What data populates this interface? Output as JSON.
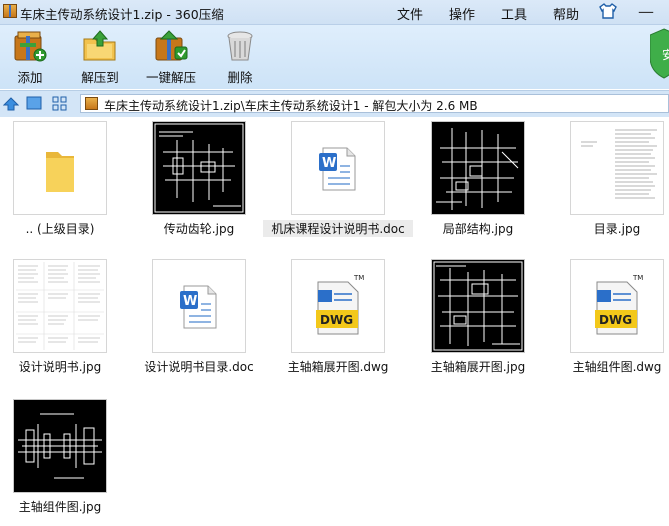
{
  "window": {
    "title": "车床主传动系统设计1.zip - 360压缩",
    "menu": [
      "文件",
      "操作",
      "工具",
      "帮助"
    ],
    "minimize_glyph": "—"
  },
  "toolbar": {
    "add": "添加",
    "extract_to": "解压到",
    "one_click_extract": "一键解压",
    "delete": "删除"
  },
  "address": {
    "path": "车床主传动系统设计1.zip\\车床主传动系统设计1 - 解包大小为 2.6 MB"
  },
  "files": [
    {
      "name": ".. (上级目录)",
      "kind": "folder",
      "icon": "folder-icon"
    },
    {
      "name": "传动齿轮.jpg",
      "kind": "jpg-dark",
      "icon": "image-thumbnail"
    },
    {
      "name": "机床课程设计说明书.doc",
      "kind": "doc",
      "icon": "word-doc-icon"
    },
    {
      "name": "局部结构.jpg",
      "kind": "jpg-dark",
      "icon": "image-thumbnail"
    },
    {
      "name": "目录.jpg",
      "kind": "jpg-doc",
      "icon": "image-thumbnail"
    },
    {
      "name": "设计说明书.jpg",
      "kind": "jpg-doc",
      "icon": "image-thumbnail"
    },
    {
      "name": "设计说明书目录.doc",
      "kind": "doc",
      "icon": "word-doc-icon"
    },
    {
      "name": "主轴箱展开图.dwg",
      "kind": "dwg",
      "icon": "dwg-file-icon"
    },
    {
      "name": "主轴箱展开图.jpg",
      "kind": "jpg-dark",
      "icon": "image-thumbnail"
    },
    {
      "name": "主轴组件图.dwg",
      "kind": "dwg",
      "icon": "dwg-file-icon"
    },
    {
      "name": "主轴组件图.jpg",
      "kind": "jpg-dark",
      "icon": "image-thumbnail"
    }
  ],
  "icons": {
    "doc_badge": "W",
    "dwg_badge": "DWG",
    "dwg_tm": "TM"
  },
  "colors": {
    "titlebar": "#d4e5f7",
    "toolbar": "#d6e8fa",
    "word_blue": "#2b6fc9",
    "dwg_yellow": "#f3c81a",
    "selected_label": "#ebebeb"
  }
}
